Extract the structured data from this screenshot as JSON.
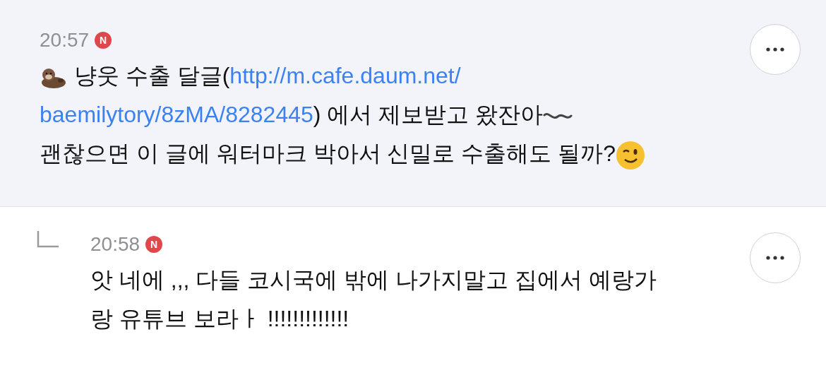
{
  "comments": [
    {
      "kind": "post",
      "time": "20:57",
      "badge": "N",
      "body": [
        {
          "kind": "otter"
        },
        {
          "kind": "text",
          "text": " 냥웃 수출 달글("
        },
        {
          "kind": "link",
          "text": "http://m.cafe.daum.net/"
        },
        {
          "kind": "break"
        },
        {
          "kind": "link",
          "text": "baemilytory/8zMA/8282445"
        },
        {
          "kind": "text",
          "text": ") 에서 제보받고 왔잔아"
        },
        {
          "kind": "wave"
        },
        {
          "kind": "break"
        },
        {
          "kind": "text",
          "text": "괜찮으면 이 글에 워터마크 박아서 신밀로 수출해도 될까?"
        },
        {
          "kind": "wink"
        }
      ]
    },
    {
      "kind": "reply",
      "time": "20:58",
      "badge": "N",
      "body": [
        {
          "kind": "text",
          "text": "앗 네에 ,,, 다들 코시국에 밖에 나가지말고 집에서 예랑가"
        },
        {
          "kind": "break"
        },
        {
          "kind": "text",
          "text": "랑 유튜브 보라ㅏ !!!!!!!!!!!!!"
        }
      ]
    }
  ]
}
